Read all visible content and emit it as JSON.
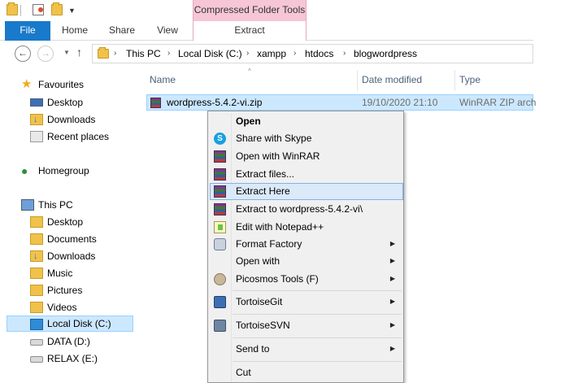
{
  "ribbon": {
    "context_tab_header": "Compressed Folder Tools",
    "tabs": {
      "file": "File",
      "home": "Home",
      "share": "Share",
      "view": "View",
      "extract": "Extract"
    }
  },
  "address_bar": {
    "crumbs": [
      "This PC",
      "Local Disk (C:)",
      "xampp",
      "htdocs",
      "blogwordpress"
    ]
  },
  "nav_pane": {
    "favourites": {
      "label": "Favourites",
      "items": [
        "Desktop",
        "Downloads",
        "Recent places"
      ]
    },
    "homegroup": "Homegroup",
    "this_pc": {
      "label": "This PC",
      "items": [
        "Desktop",
        "Documents",
        "Downloads",
        "Music",
        "Pictures",
        "Videos",
        "Local Disk (C:)",
        "DATA (D:)",
        "RELAX (E:)"
      ]
    },
    "selected_item": "Local Disk (C:)"
  },
  "file_list": {
    "columns": {
      "name": "Name",
      "date_modified": "Date modified",
      "type": "Type"
    },
    "files": [
      {
        "name": "wordpress-5.4.2-vi.zip",
        "date_modified": "19/10/2020 21:10",
        "type": "WinRAR ZIP arch"
      }
    ]
  },
  "context_menu": {
    "items": [
      {
        "label": "Open",
        "icon": "none",
        "bold": true
      },
      {
        "label": "Share with Skype",
        "icon": "skype-icon"
      },
      {
        "label": "Open with WinRAR",
        "icon": "winrar-icon"
      },
      {
        "label": "Extract files...",
        "icon": "winrar-icon"
      },
      {
        "label": "Extract Here",
        "icon": "winrar-icon",
        "highlighted": true
      },
      {
        "label": "Extract to wordpress-5.4.2-vi\\",
        "icon": "winrar-icon"
      },
      {
        "label": "Edit with Notepad++",
        "icon": "notepad-plus-plus-icon"
      },
      {
        "label": "Format Factory",
        "icon": "format-factory-icon",
        "submenu": true
      },
      {
        "label": "Open with",
        "icon": "none",
        "submenu": true
      },
      {
        "label": "Picosmos Tools (F)",
        "icon": "picosmos-icon",
        "submenu": true
      },
      {
        "label": "TortoiseGit",
        "icon": "tortoisegit-icon",
        "submenu": true
      },
      {
        "label": "TortoiseSVN",
        "icon": "tortoisesvn-icon",
        "submenu": true
      },
      {
        "label": "Send to",
        "icon": "none",
        "submenu": true
      },
      {
        "label": "Cut",
        "icon": "none"
      }
    ]
  },
  "colors": {
    "file_tab": "#1979ca",
    "context_tab": "#f6c6d6",
    "selection": "#cce8ff",
    "menu_background": "#f0f0f0"
  }
}
